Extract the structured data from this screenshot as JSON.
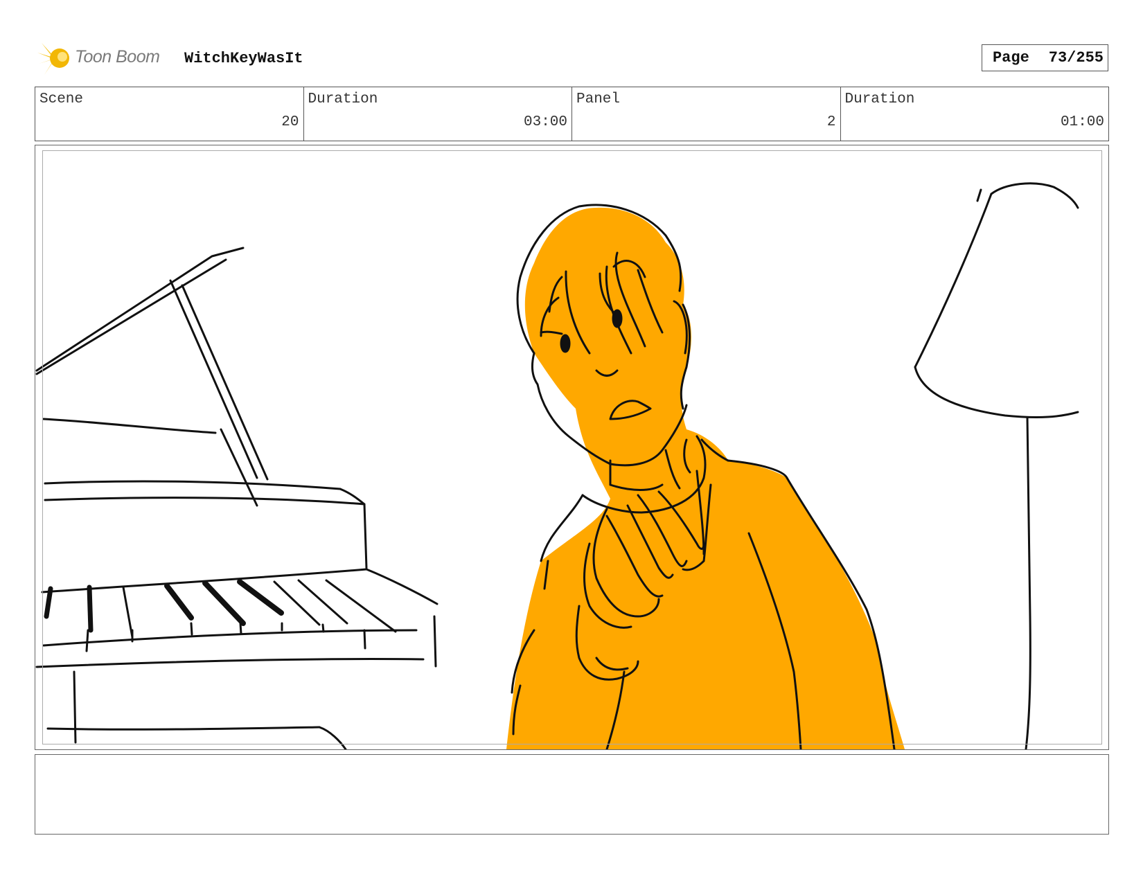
{
  "header": {
    "logo_text": "Toon Boom",
    "project_title": "WitchKeyWasIt",
    "page_label": "Page",
    "page_value": "73/255"
  },
  "info": [
    {
      "label": "Scene",
      "value": "20"
    },
    {
      "label": "Duration",
      "value": "03:00"
    },
    {
      "label": "Panel",
      "value": "2"
    },
    {
      "label": "Duration",
      "value": "01:00"
    }
  ],
  "colors": {
    "character_fill": "#FFA800",
    "logo_yellow": "#F7C51E",
    "line": "#111111"
  },
  "notes": ""
}
